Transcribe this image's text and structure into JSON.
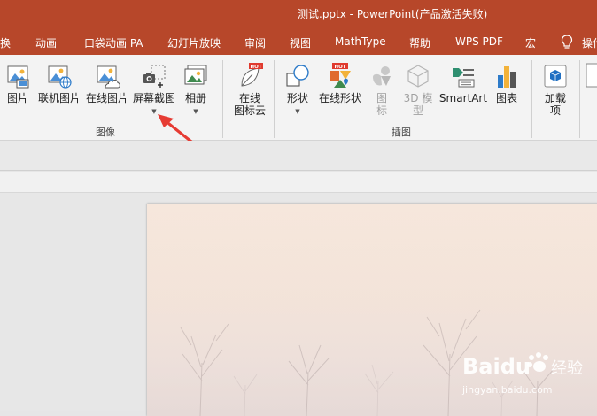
{
  "window": {
    "title": "测试.pptx  -  PowerPoint(产品激活失败)"
  },
  "tabs": [
    {
      "label": "换"
    },
    {
      "label": "动画"
    },
    {
      "label": "口袋动画 PA"
    },
    {
      "label": "幻灯片放映"
    },
    {
      "label": "审阅"
    },
    {
      "label": "视图"
    },
    {
      "label": "MathType"
    },
    {
      "label": "帮助"
    },
    {
      "label": "WPS PDF"
    },
    {
      "label": "宏"
    },
    {
      "label": "操作"
    }
  ],
  "ribbon": {
    "images_group": {
      "label": "图像",
      "buttons": [
        {
          "label": "图片",
          "icon": "picture-icon"
        },
        {
          "label": "联机图片",
          "icon": "online-picture-icon"
        },
        {
          "label": "在线图片",
          "icon": "cloud-picture-icon"
        },
        {
          "label": "屏幕截图",
          "icon": "screenshot-icon"
        },
        {
          "label": "相册",
          "icon": "photo-album-icon"
        }
      ]
    },
    "online_icons": {
      "label_line1": "在线",
      "label_line2": "图标云",
      "badge": "HOT"
    },
    "illustrations_group": {
      "label": "插图",
      "buttons": [
        {
          "label": "形状",
          "icon": "shapes-icon"
        },
        {
          "label": "在线形状",
          "icon": "online-shapes-icon",
          "badge": "HOT"
        },
        {
          "label_line1": "图",
          "label_line2": "标",
          "icon": "icons-icon",
          "disabled": true
        },
        {
          "label_line1": "3D 模",
          "label_line2": "型",
          "icon": "3d-model-icon",
          "disabled": true
        },
        {
          "label": "SmartArt",
          "icon": "smartart-icon"
        },
        {
          "label": "图表",
          "icon": "chart-icon"
        }
      ]
    },
    "addins": {
      "label_line1": "加载",
      "label_line2": "项"
    }
  },
  "watermark": {
    "brand": "Baidu",
    "brand_suffix": "经验",
    "url": "jingyan.baidu.com"
  },
  "colors": {
    "accent": "#b7472a",
    "arrow": "#e63b33"
  }
}
